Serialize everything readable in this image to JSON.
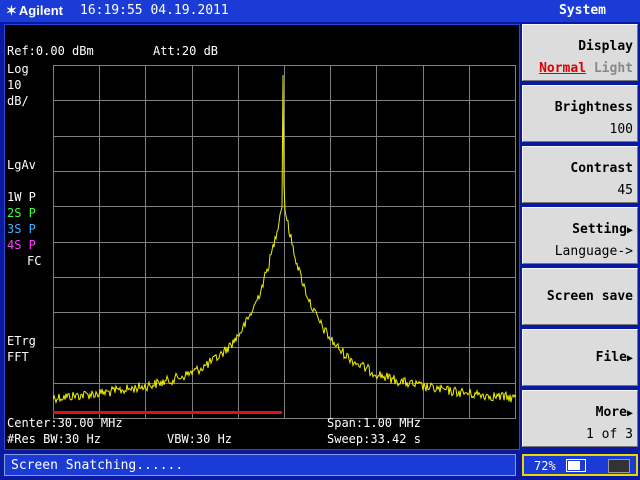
{
  "header": {
    "brand": "Agilent",
    "datetime": "16:19:55 04.19.2011",
    "menu_title": "System"
  },
  "screen": {
    "ref_label": "Ref:0.00 dBm",
    "att_label": "Att:20 dB",
    "left_annotations": {
      "scale_type": "Log",
      "scale_value": "10",
      "scale_unit": "dB/",
      "detector": "LgAv",
      "trace1": "1W P",
      "trace2": "2S P",
      "trace3": "3S P",
      "trace4": "4S P",
      "coupling": "FC",
      "trigger": "ETrg",
      "mode": "FFT"
    },
    "bottom": {
      "center": "Center:30.00 MHz",
      "span": "Span:1.00 MHz",
      "rbw": "#Res BW:30 Hz",
      "vbw": "VBW:30 Hz",
      "sweep": "Sweep:33.42 s"
    },
    "colors": {
      "trace": "#f0f000",
      "grid": "#7f7f7f",
      "progress": "#e01010",
      "trace1": "#ffffff",
      "trace2": "#40ff40",
      "trace3": "#40b0ff",
      "trace4": "#ff40ff"
    }
  },
  "softkeys": [
    {
      "label": "Display",
      "option_selected": "Normal",
      "option_other": "Light"
    },
    {
      "label": "Brightness",
      "value": "100"
    },
    {
      "label": "Contrast",
      "value": "45"
    },
    {
      "label": "Setting",
      "value": "Language->"
    },
    {
      "label": "Screen save"
    },
    {
      "label": "File"
    },
    {
      "label": "More",
      "value": "1 of 3"
    }
  ],
  "status": {
    "message": "Screen Snatching......"
  },
  "battery": {
    "percent_text": "72%",
    "level": 0.72
  }
}
